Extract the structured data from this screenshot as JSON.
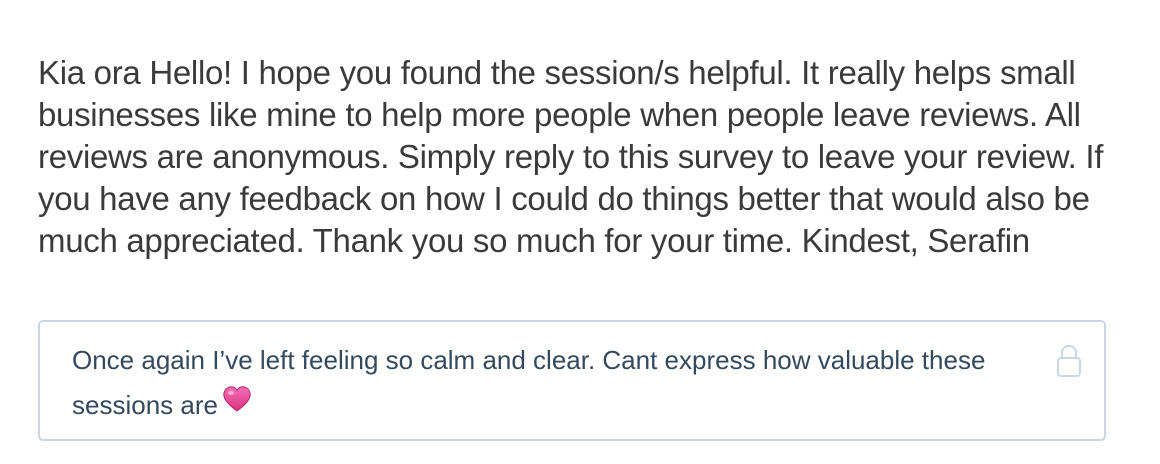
{
  "survey": {
    "intro_text": "Kia ora Hello! I hope you found the session/s helpful. It really helps small businesses like mine to help more people when people leave reviews. All reviews are anonymous. Simply reply to this survey to leave your review. If you have any feedback on how I could do things better that would also be much appreciated. Thank you so much for your time. Kindest, Serafin"
  },
  "response": {
    "text": "Once again I’ve left feeling so calm and clear. Cant express how valuable these sessions are",
    "emoji_icon": "pink-heart-icon",
    "lock_icon": "lock-icon",
    "heart_color": "#e8459a",
    "border_color": "#c9d6e4"
  }
}
